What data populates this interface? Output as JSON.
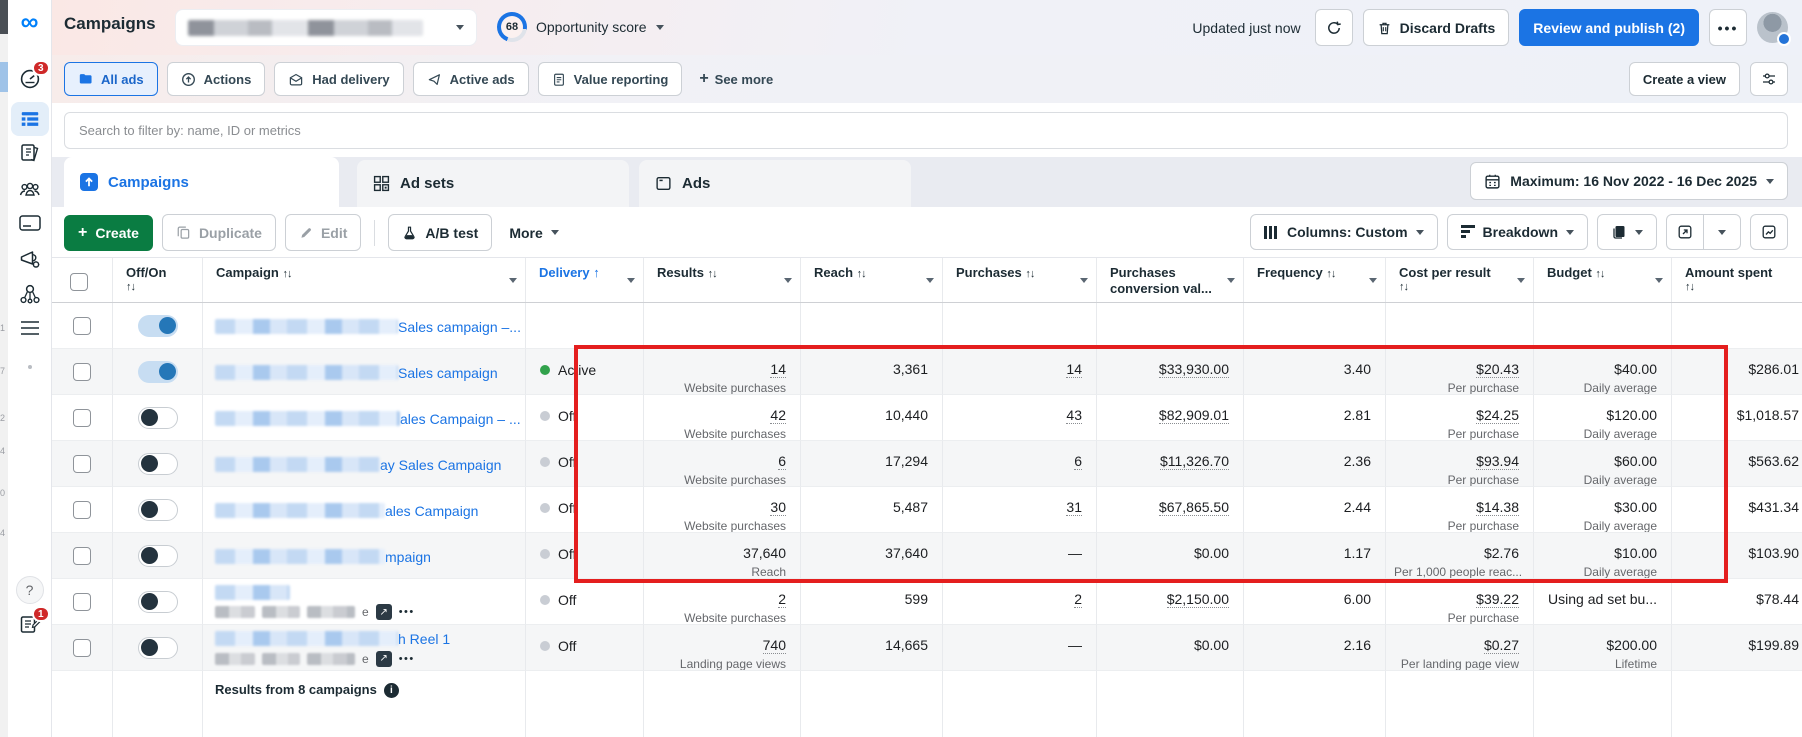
{
  "edge": {
    "fragments": [
      "1",
      "7",
      "2",
      "4",
      "0",
      "4"
    ]
  },
  "sidebar": {
    "badge_top": "3",
    "badge_bottom": "1",
    "help": "?"
  },
  "header": {
    "title": "Campaigns",
    "opportunity_score": "68",
    "opportunity_label": "Opportunity score",
    "updated": "Updated just now",
    "discard": "Discard Drafts",
    "publish": "Review and publish (2)",
    "more": "•••"
  },
  "pills": {
    "items": [
      {
        "label": "All ads",
        "icon": "folder-icon",
        "active": true
      },
      {
        "label": "Actions",
        "icon": "arrow-up-circle-icon",
        "active": false
      },
      {
        "label": "Had delivery",
        "icon": "envelope-icon",
        "active": false
      },
      {
        "label": "Active ads",
        "icon": "send-icon",
        "active": false
      },
      {
        "label": "Value reporting",
        "icon": "report-icon",
        "active": false
      }
    ],
    "see_more": "See more",
    "create_view": "Create a view"
  },
  "search": {
    "placeholder": "Search to filter by: name, ID or metrics"
  },
  "tabs": [
    {
      "label": "Campaigns",
      "active": true
    },
    {
      "label": "Ad sets",
      "active": false
    },
    {
      "label": "Ads",
      "active": false
    }
  ],
  "date_range": "Maximum: 16 Nov 2022 - 16 Dec 2025",
  "toolbar": {
    "create": "Create",
    "duplicate": "Duplicate",
    "edit": "Edit",
    "ab_test": "A/B test",
    "more": "More",
    "columns": "Columns: Custom",
    "breakdown": "Breakdown"
  },
  "table": {
    "headers": {
      "offon": "Off/On",
      "campaign": "Campaign",
      "delivery": "Delivery",
      "results": "Results",
      "reach": "Reach",
      "purchases": "Purchases",
      "conv": "Purchases conversion val...",
      "frequency": "Frequency",
      "cpr": "Cost per result",
      "budget": "Budget",
      "spent": "Amount spent"
    },
    "rows": [
      {
        "toggle": "on",
        "blur": 183,
        "name": "Sales campaign –...",
        "two_line": false,
        "status": "",
        "results": null,
        "reach": "",
        "purchases": null,
        "conv": null,
        "freq": "",
        "cpr": null,
        "budget": null,
        "spent": ""
      },
      {
        "toggle": "on",
        "blur": 183,
        "name": "Sales campaign",
        "two_line": false,
        "status": "Active",
        "results": {
          "v": "14",
          "label": "Website purchases",
          "link": true
        },
        "reach": "3,361",
        "purchases": {
          "v": "14",
          "link": true
        },
        "conv": {
          "v": "$33,930.00",
          "link": true
        },
        "freq": "3.40",
        "cpr": {
          "v": "$20.43",
          "label": "Per purchase",
          "link": true
        },
        "budget": {
          "v": "$40.00",
          "label": "Daily average"
        },
        "spent": "$286.01"
      },
      {
        "toggle": "off",
        "blur": 185,
        "name": "ales Campaign – ...",
        "two_line": false,
        "status": "Off",
        "results": {
          "v": "42",
          "label": "Website purchases",
          "link": true
        },
        "reach": "10,440",
        "purchases": {
          "v": "43",
          "link": true
        },
        "conv": {
          "v": "$82,909.01",
          "link": true
        },
        "freq": "2.81",
        "cpr": {
          "v": "$24.25",
          "label": "Per purchase",
          "link": true
        },
        "budget": {
          "v": "$120.00",
          "label": "Daily average"
        },
        "spent": "$1,018.57"
      },
      {
        "toggle": "off",
        "blur": 165,
        "name": "ay Sales Campaign",
        "two_line": false,
        "status": "Off",
        "results": {
          "v": "6",
          "label": "Website purchases",
          "link": true
        },
        "reach": "17,294",
        "purchases": {
          "v": "6",
          "link": true
        },
        "conv": {
          "v": "$11,326.70",
          "link": true
        },
        "freq": "2.36",
        "cpr": {
          "v": "$93.94",
          "label": "Per purchase",
          "link": true
        },
        "budget": {
          "v": "$60.00",
          "label": "Daily average"
        },
        "spent": "$563.62"
      },
      {
        "toggle": "off",
        "blur": 170,
        "name": "ales Campaign",
        "two_line": false,
        "status": "Off",
        "results": {
          "v": "30",
          "label": "Website purchases",
          "link": true
        },
        "reach": "5,487",
        "purchases": {
          "v": "31",
          "link": true
        },
        "conv": {
          "v": "$67,865.50",
          "link": true
        },
        "freq": "2.44",
        "cpr": {
          "v": "$14.38",
          "label": "Per purchase",
          "link": true
        },
        "budget": {
          "v": "$30.00",
          "label": "Daily average"
        },
        "spent": "$431.34"
      },
      {
        "toggle": "off",
        "blur": 170,
        "name": "mpaign",
        "two_line": false,
        "status": "Off",
        "results": {
          "v": "37,640",
          "label": "Reach",
          "link": false
        },
        "reach": "37,640",
        "purchases": {
          "v": "—",
          "link": false
        },
        "conv": {
          "v": "$0.00",
          "link": false
        },
        "freq": "1.17",
        "cpr": {
          "v": "$2.76",
          "label": "Per 1,000 people reac...",
          "link": false
        },
        "budget": {
          "v": "$10.00",
          "label": "Daily average"
        },
        "spent": "$103.90"
      },
      {
        "toggle": "off",
        "blur": 75,
        "name": "",
        "two_line": true,
        "line2_tail": "e",
        "status": "Off",
        "results": {
          "v": "2",
          "label": "Website purchases",
          "link": true
        },
        "reach": "599",
        "purchases": {
          "v": "2",
          "link": true
        },
        "conv": {
          "v": "$2,150.00",
          "link": true
        },
        "freq": "6.00",
        "cpr": {
          "v": "$39.22",
          "label": "Per purchase",
          "link": true
        },
        "budget": {
          "v": "Using ad set bu...",
          "label": ""
        },
        "spent": "$78.44"
      },
      {
        "toggle": "off",
        "blur": 183,
        "name": "h Reel 1",
        "two_line": true,
        "line2_tail": "e",
        "status": "Off",
        "results": {
          "v": "740",
          "label": "Landing page views",
          "link": true
        },
        "reach": "14,665",
        "purchases": {
          "v": "—",
          "link": false
        },
        "conv": {
          "v": "$0.00",
          "link": false
        },
        "freq": "2.16",
        "cpr": {
          "v": "$0.27",
          "label": "Per landing page view",
          "link": true
        },
        "budget": {
          "v": "$200.00",
          "label": "Lifetime"
        },
        "spent": "$199.89"
      }
    ],
    "footer": "Results from 8 campaigns"
  },
  "highlight": {
    "color": "#e41e1e"
  }
}
